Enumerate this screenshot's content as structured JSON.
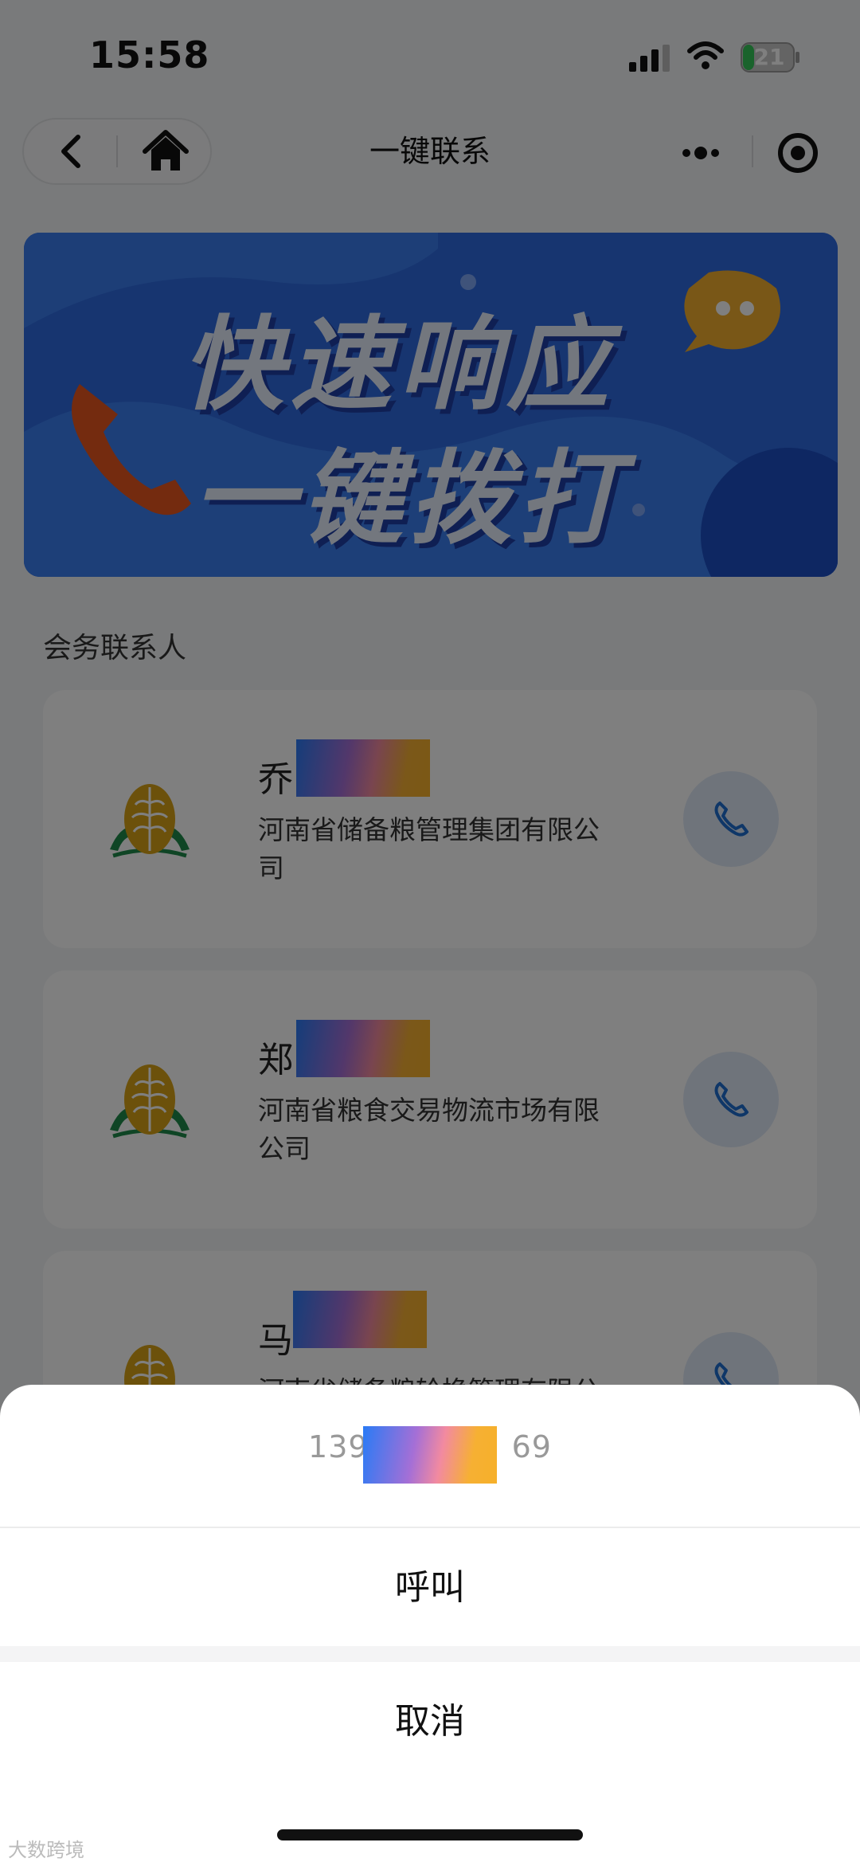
{
  "status_bar": {
    "time": "15:58",
    "battery": "21"
  },
  "nav": {
    "title": "一键联系"
  },
  "banner": {
    "line1": "快速响应",
    "line2": "一键拨打"
  },
  "section": {
    "title": "会务联系人"
  },
  "contacts": [
    {
      "surname": "乔",
      "org": "河南省储备粮管理集团有限公司"
    },
    {
      "surname": "郑",
      "org": "河南省粮食交易物流市场有限公司"
    },
    {
      "surname": "马",
      "org": "河南省储备粮轮换管理有限公"
    }
  ],
  "action_sheet": {
    "phone_prefix": "139",
    "phone_suffix": "69",
    "call_label": "呼叫",
    "cancel_label": "取消"
  },
  "watermark": "大数跨境",
  "colors": {
    "accent": "#2f6ae0",
    "call_icon": "#1f6fd1",
    "logo_green": "#1f8a4a",
    "logo_gold": "#d8a317"
  }
}
